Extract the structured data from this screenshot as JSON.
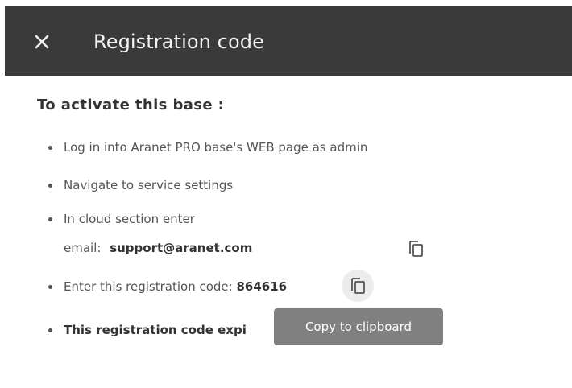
{
  "header": {
    "title": "Registration code",
    "close_icon": "close-icon",
    "background": "#3a3a3a"
  },
  "content": {
    "title": "To activate this base :",
    "steps": [
      "Log in into Aranet PRO base's WEB page as admin",
      "Navigate to service settings",
      "In cloud section enter"
    ],
    "email_label": "email:",
    "email_value": "support@aranet.com",
    "code_label": "Enter this registration code:",
    "code_value": "864616",
    "expire_text": "This registration code expi",
    "copy_icon": "copy-icon"
  },
  "tooltip": {
    "text": "Copy to clipboard"
  }
}
